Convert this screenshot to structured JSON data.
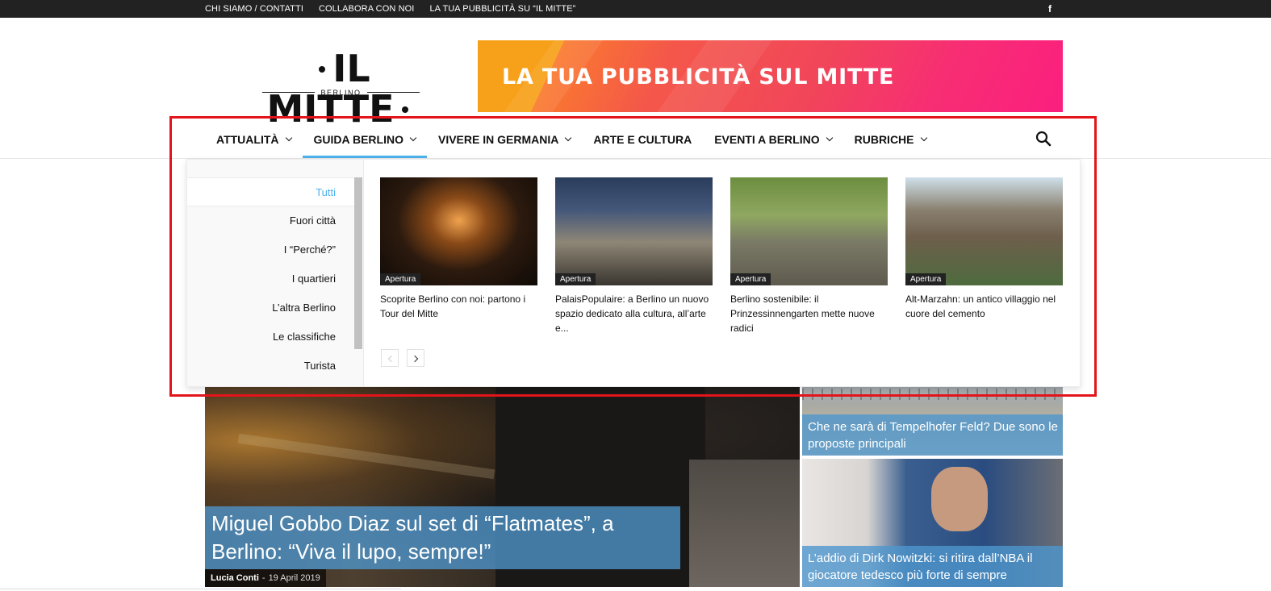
{
  "topbar": {
    "links": [
      "CHI SIAMO / CONTATTI",
      "COLLABORA CON NOI",
      "LA TUA PUBBLICITÀ SU “IL MITTE”"
    ],
    "social_icon": "facebook-icon",
    "social_glyph": "f"
  },
  "header": {
    "logo_main": "IL MITTE",
    "logo_sub": "BERLINO",
    "banner_text": "LA TUA PUBBLICITÀ SUL MITTE"
  },
  "nav": {
    "items": [
      {
        "label": "ATTUALITÀ",
        "has_dropdown": true
      },
      {
        "label": "GUIDA BERLINO",
        "has_dropdown": true,
        "active": true
      },
      {
        "label": "VIVERE IN GERMANIA",
        "has_dropdown": true
      },
      {
        "label": "ARTE E CULTURA",
        "has_dropdown": false
      },
      {
        "label": "EVENTI A BERLINO",
        "has_dropdown": true
      },
      {
        "label": "RUBRICHE",
        "has_dropdown": true
      }
    ],
    "search_icon": "search-icon",
    "accent_color": "#4db2ec"
  },
  "mega_menu": {
    "categories": [
      "Tutti",
      "Fuori città",
      "I “Perché?”",
      "I quartieri",
      "L’altra Berlino",
      "Le classifiche",
      "Turista"
    ],
    "selected": "Tutti",
    "articles": [
      {
        "badge": "Apertura",
        "title": "Scoprite Berlino con noi: partono i Tour del Mitte"
      },
      {
        "badge": "Apertura",
        "title": "PalaisPopulaire: a Berlino un nuovo spazio dedicato alla cultura, all’arte e..."
      },
      {
        "badge": "Apertura",
        "title": "Berlino sostenibile: il Prinzessinnengarten mette nuove radici"
      },
      {
        "badge": "Apertura",
        "title": "Alt-Marzahn: un antico villaggio nel cuore del cemento"
      }
    ]
  },
  "featured": {
    "main_title": "Miguel Gobbo Diaz sul set di “Flatmates”, a Berlino: “Viva il lupo, sempre!”",
    "author": "Lucia Conti",
    "separator": "-",
    "date": "19 April 2019",
    "side": [
      {
        "title": "Che ne sarà di Tempelhofer Feld? Due sono le proposte principali"
      },
      {
        "title": "L’addio di Dirk Nowitzki: si ritira dall’NBA il giocatore tedesco più forte di sempre"
      }
    ]
  },
  "colors": {
    "highlight": "#e3141b",
    "caption_bg": "#4e96cd",
    "topbar_bg": "#222222"
  }
}
